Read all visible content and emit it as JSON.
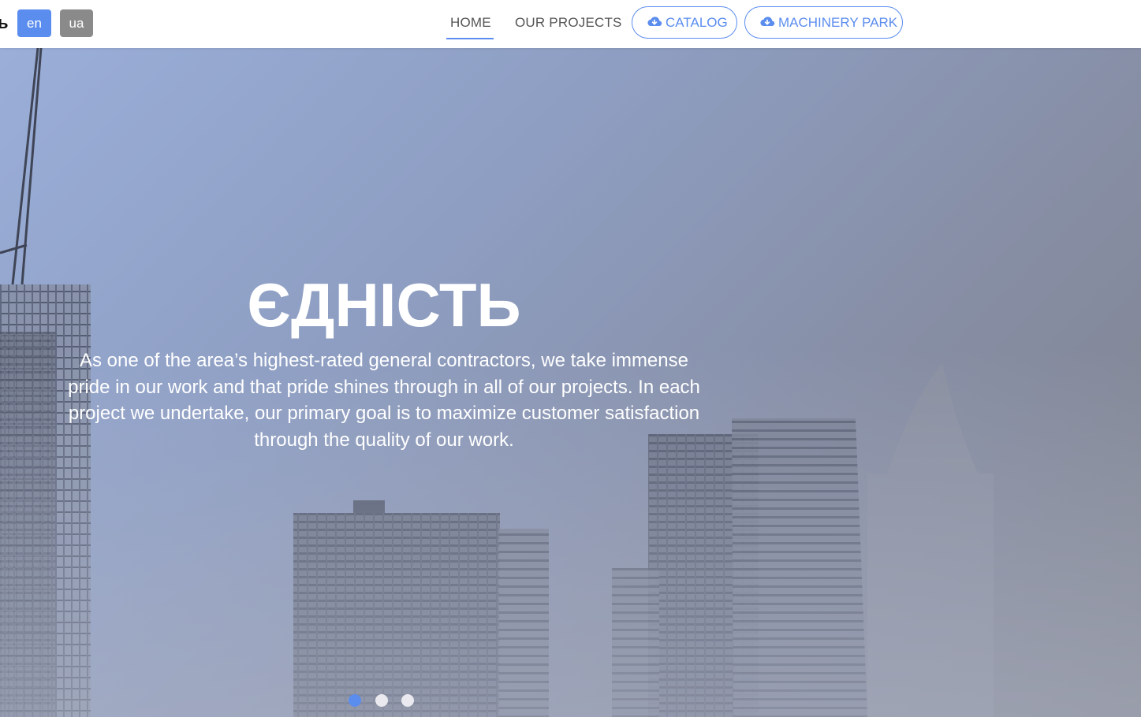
{
  "header": {
    "logo_fragment": "ь",
    "languages": [
      {
        "label": "en",
        "active": true
      },
      {
        "label": "ua",
        "active": false
      }
    ],
    "nav": [
      {
        "label": "HOME",
        "active": true
      },
      {
        "label": "OUR PROJECTS",
        "active": false
      }
    ],
    "buttons": [
      {
        "label": "CATALOG",
        "icon": "cloud-download-icon"
      },
      {
        "label": "MACHINERY PARK",
        "icon": "cloud-download-icon"
      }
    ]
  },
  "hero": {
    "title": "ЄДНІСТЬ",
    "text": "As one of the area’s highest-rated general contractors, we take immense pride in our work and that pride shines through in all of our projects. In each project we undertake, our primary goal is to maximize customer satisfaction through the quality of our work.",
    "slides": [
      {
        "active": true
      },
      {
        "active": false
      },
      {
        "active": false
      }
    ]
  },
  "colors": {
    "accent": "#5b8def",
    "language_inactive": "#8a8a8a",
    "nav_text": "#555555",
    "hero_overlay": "#8e9ec2",
    "dot_inactive": "#e9e9ef"
  }
}
